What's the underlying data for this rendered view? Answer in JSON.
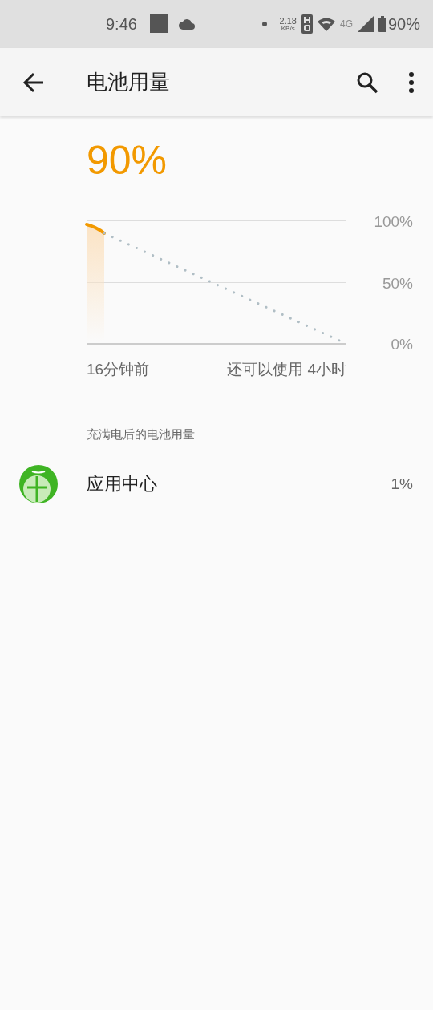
{
  "status_bar": {
    "time": "9:46",
    "net_speed": "2.18",
    "net_unit": "KB/s",
    "network_type": "4G",
    "battery": "90%"
  },
  "toolbar": {
    "title": "电池用量"
  },
  "battery": {
    "percent": "90%",
    "axis_labels": [
      "100%",
      "50%",
      "0%"
    ],
    "start_label": "16分钟前",
    "remaining_label": "还可以使用 4小时"
  },
  "section": {
    "header": "充满电后的电池用量",
    "apps": [
      {
        "name": "应用中心",
        "usage": "1%"
      }
    ]
  }
}
